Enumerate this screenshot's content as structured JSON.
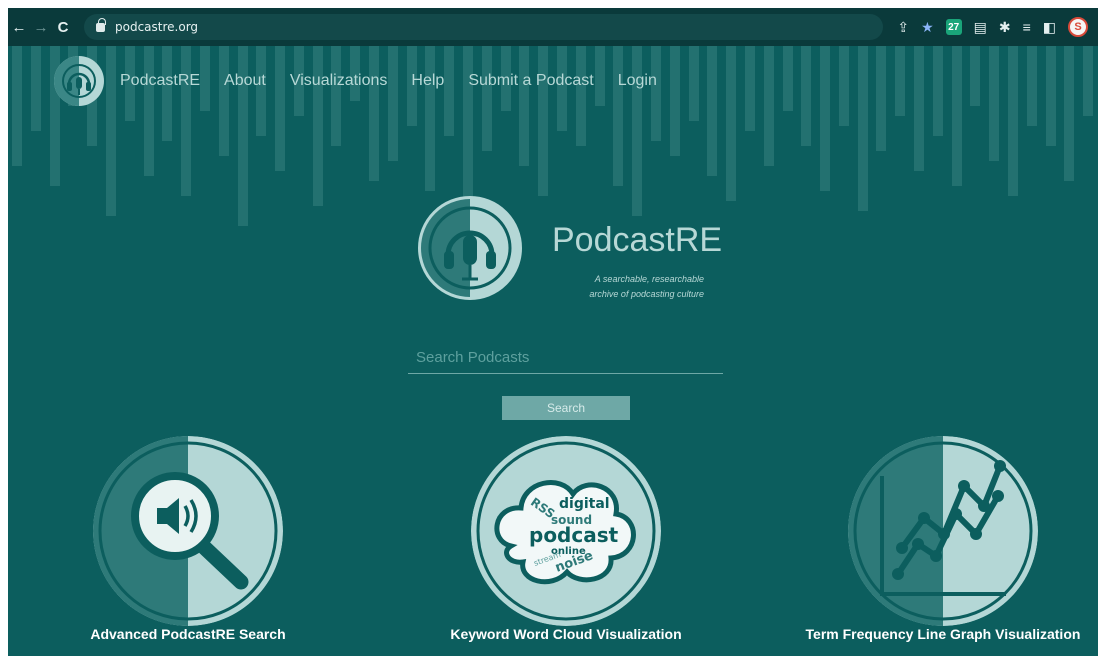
{
  "browser": {
    "url": "podcastre.org",
    "back_icon": "←",
    "forward_icon": "→",
    "reload_icon": "C",
    "extension_badge": "27",
    "profile_initial": "S"
  },
  "nav": {
    "links": [
      "PodcastRE",
      "About",
      "Visualizations",
      "Help",
      "Submit a Podcast",
      "Login"
    ]
  },
  "hero": {
    "title": "PodcastRE",
    "tagline_line1": "A searchable, researchable",
    "tagline_line2": "archive of podcasting culture"
  },
  "search": {
    "placeholder": "Search Podcasts",
    "button_label": "Search"
  },
  "features": [
    {
      "label": "Advanced PodcastRE Search",
      "icon": "magnifier-speaker-icon"
    },
    {
      "label": "Keyword Word Cloud Visualization",
      "icon": "word-cloud-icon",
      "words": [
        "RSS",
        "digital",
        "sound",
        "podcast",
        "online",
        "stream",
        "noise"
      ]
    },
    {
      "label": "Term Frequency Line Graph Visualization",
      "icon": "line-graph-icon"
    }
  ],
  "colors": {
    "page_bg": "#0c5e5e",
    "accent_light": "#b4d7d6",
    "accent_mid": "#3b8786",
    "browser_bar": "#0a3a3b"
  }
}
